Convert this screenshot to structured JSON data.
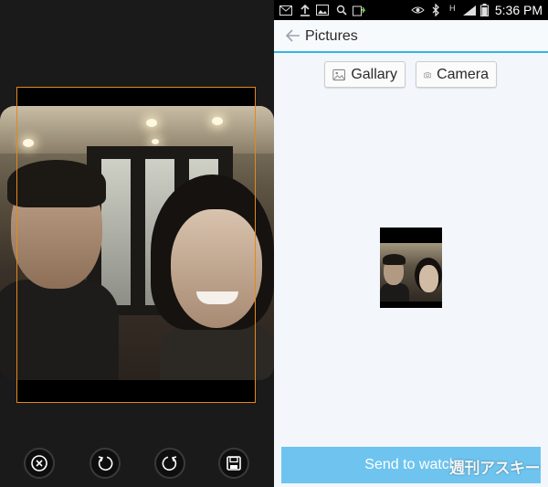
{
  "editor": {
    "tools": [
      {
        "name": "cancel-button",
        "icon": "close-circle-icon"
      },
      {
        "name": "rotate-left-button",
        "icon": "rotate-ccw-icon"
      },
      {
        "name": "rotate-right-button",
        "icon": "rotate-cw-icon"
      },
      {
        "name": "save-button",
        "icon": "floppy-disk-icon"
      }
    ],
    "crop_color": "#e08a1e"
  },
  "statusbar": {
    "time": "5:36 PM",
    "network_label": "H",
    "icons": [
      "mail-icon",
      "upload-icon",
      "image-icon",
      "search-icon",
      "battery-charging-icon",
      "eye-icon",
      "bluetooth-icon",
      "signal-icon",
      "battery-icon"
    ]
  },
  "screen": {
    "title": "Pictures",
    "gallery_label": "Gallary",
    "camera_label": "Camera",
    "send_label": "Send to watch",
    "watermark": "週刊アスキー",
    "accent": "#33b5e5",
    "send_color": "#6ec4ef"
  }
}
